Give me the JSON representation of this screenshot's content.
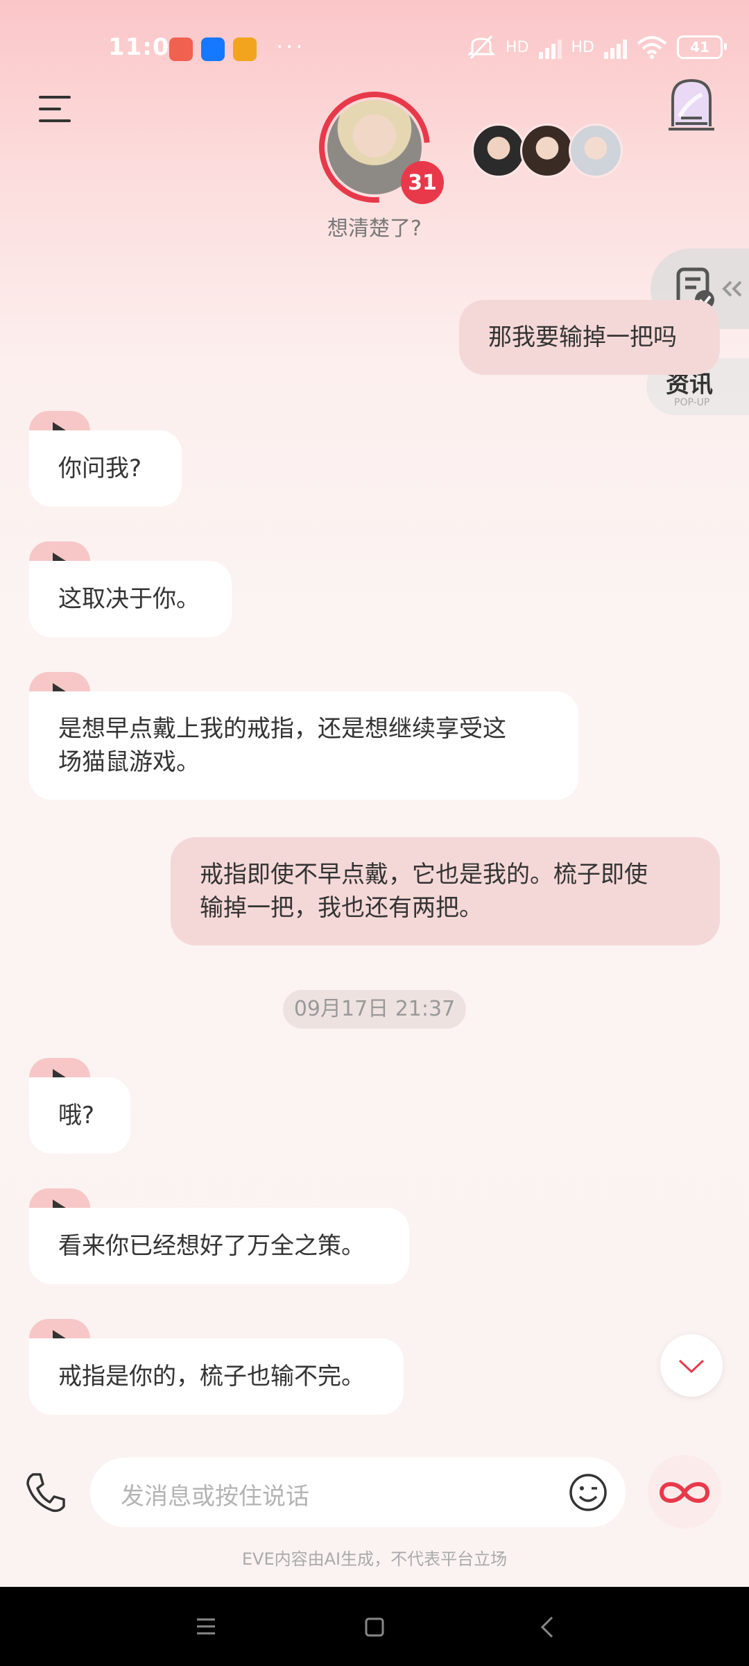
{
  "status_bar": {
    "time": "11:01",
    "app_icons": [
      "#f0614f",
      "#1677ff",
      "#f2a41f"
    ],
    "more": "···",
    "network_label_1": "HD",
    "network_label_2": "HD",
    "battery": "41"
  },
  "header": {
    "character_mood": "想清楚了?",
    "affinity_badge": "31",
    "menu_icon": "menu-icon",
    "castle_icon": "castle-icon"
  },
  "side": {
    "news_icon": "news-doc-icon",
    "popup_label": "资讯",
    "popup_sub": "POP-UP"
  },
  "messages": [
    {
      "role": "user",
      "text": "那我要输掉一把吗"
    },
    {
      "role": "bot",
      "text": "你问我?"
    },
    {
      "role": "bot",
      "text": "这取决于你。"
    },
    {
      "role": "bot",
      "lines": [
        "是想早点戴上我的戒指，还是想继续享受这",
        "场猫鼠游戏。"
      ]
    },
    {
      "role": "user",
      "lines": [
        "戒指即使不早点戴，它也是我的。梳子即使",
        "输掉一把，我也还有两把。"
      ]
    },
    {
      "role": "time",
      "text": "09月17日 21:37"
    },
    {
      "role": "bot",
      "text": "哦?"
    },
    {
      "role": "bot",
      "text": "看来你已经想好了万全之策。"
    },
    {
      "role": "bot",
      "text": "戒指是你的，梳子也输不完。"
    }
  ],
  "input_bar": {
    "placeholder": "发消息或按住说话",
    "disclaimer": "EVE内容由AI生成，不代表平台立场"
  },
  "colors": {
    "accent": "#e8394b",
    "user_bubble": "#f4d8d7",
    "bot_bubble": "#ffffff",
    "play_tag": "#f7c7c7"
  }
}
